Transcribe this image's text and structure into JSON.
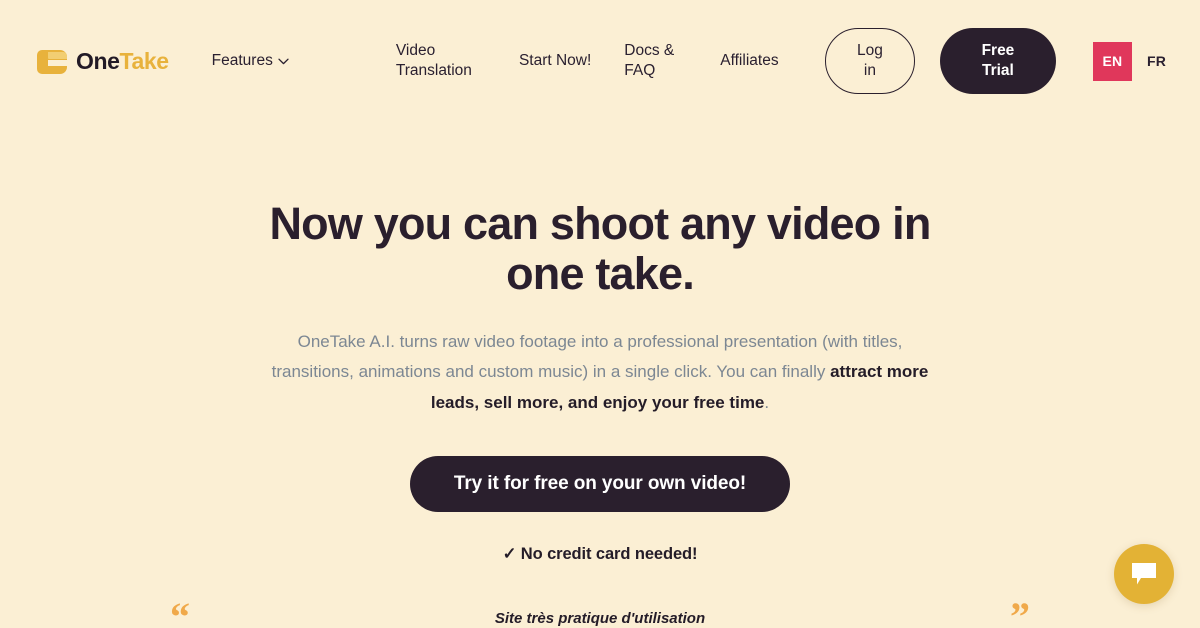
{
  "brand": {
    "logo_icon": "onetake-mascot-icon",
    "name_part_one": "One",
    "name_part_two": "Take",
    "color_gold": "#E8B23C",
    "color_dark": "#2A1F2D"
  },
  "header": {
    "nav": [
      {
        "label": "Features",
        "has_dropdown": true,
        "icon": "chevron-down-icon"
      },
      {
        "label": "Video\nTranslation",
        "has_dropdown": false
      },
      {
        "label": "Start Now!",
        "has_dropdown": false
      },
      {
        "label": "Docs &\nFAQ",
        "has_dropdown": false
      },
      {
        "label": "Affiliates",
        "has_dropdown": false
      }
    ],
    "login_label": "Log\nin",
    "trial_label": "Free\nTrial",
    "language": {
      "active": "EN",
      "alternate": "FR",
      "active_color": "#E0375B"
    }
  },
  "hero": {
    "title_line_1": "Now you can shoot any video",
    "title_line_2": "in one take.",
    "subtitle_line_1": "OneTake A.I. turns raw video footage into a professional presentation (with",
    "subtitle_line_2": "titles, transitions, animations and custom music) in a single click.",
    "subtitle_line_3_prefix": "You can finally ",
    "subtitle_line_3_bold": "attract more leads, sell more, and enjoy your free time",
    "subtitle_line_3_suffix": ".",
    "cta_label": "Try it for free on your own video!",
    "no_credit_card": "✓ No credit card needed!"
  },
  "testimonial": {
    "open_quote": "“",
    "close_quote": "”",
    "text": "Site très pratique d'utilisation",
    "quote_color": "#F0A94A"
  },
  "chat": {
    "icon": "chat-bubble-icon",
    "button_color": "#E3B235"
  },
  "page": {
    "background": "#FBEFD4"
  }
}
